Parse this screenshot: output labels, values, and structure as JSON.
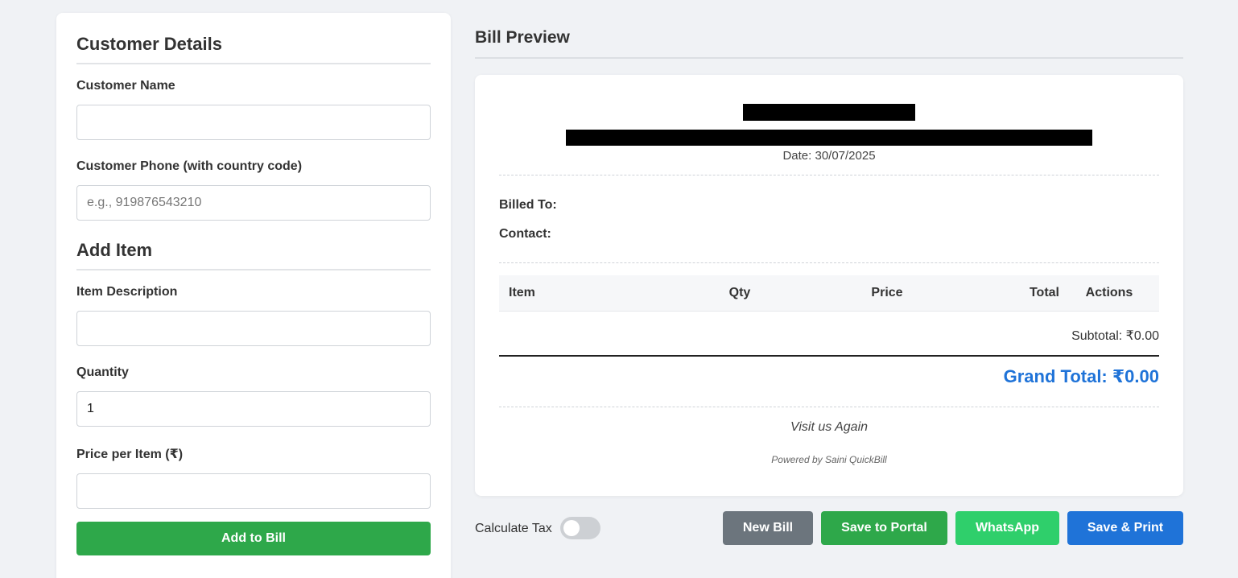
{
  "customer_section": {
    "title": "Customer Details",
    "name_label": "Customer Name",
    "name_value": "",
    "phone_label": "Customer Phone (with country code)",
    "phone_placeholder": "e.g., 919876543210"
  },
  "item_section": {
    "title": "Add Item",
    "description_label": "Item Description",
    "description_value": "",
    "quantity_label": "Quantity",
    "quantity_value": "1",
    "price_label": "Price per Item (₹)",
    "price_value": "",
    "add_button": "Add to Bill"
  },
  "preview": {
    "title": "Bill Preview",
    "date": "Date: 30/07/2025",
    "billed_to_label": "Billed To:",
    "contact_label": "Contact:",
    "table_headers": [
      "Item",
      "Qty",
      "Price",
      "Total",
      "Actions"
    ],
    "subtotal": "Subtotal: ₹0.00",
    "grand_total": "Grand Total: ₹0.00",
    "footer_message": "Visit us Again",
    "powered_by": "Powered by Saini QuickBill"
  },
  "actions": {
    "tax_label": "Calculate Tax",
    "tax_enabled": false,
    "new_bill": "New Bill",
    "save_portal": "Save to Portal",
    "whatsapp": "WhatsApp",
    "save_print": "Save & Print"
  },
  "colors": {
    "green": "#2ea84a",
    "whatsapp_green": "#2fcf6b",
    "blue": "#1f73d8",
    "gray": "#6c757d"
  }
}
